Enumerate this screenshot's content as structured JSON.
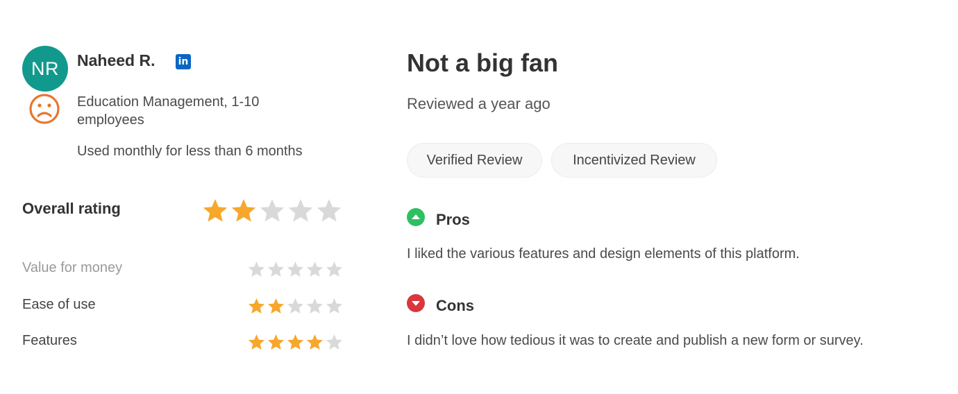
{
  "reviewer": {
    "initials": "NR",
    "name": "Naheed R.",
    "linkedin_label": "in",
    "sentiment_icon": "frown-face-icon",
    "industry": "Education Management, 1-10 employees",
    "usage": "Used monthly for less than 6 months",
    "avatar_color": "#12998d"
  },
  "ratings": {
    "overall_label": "Overall rating",
    "overall_value": 2,
    "max": 5,
    "items": [
      {
        "label": "Value for money",
        "value": 0
      },
      {
        "label": "Ease of use",
        "value": 2
      },
      {
        "label": "Features",
        "value": 4
      },
      {
        "label": "",
        "value": 4
      }
    ],
    "star_color_filled": "#f7a72b",
    "star_color_empty": "#d9d9d9"
  },
  "review": {
    "title": "Not a big fan",
    "date": "Reviewed a year ago",
    "badges": [
      "Verified Review",
      "Incentivized Review"
    ],
    "pros_title": "Pros",
    "pros_text": "I liked the various features and design elements of this platform.",
    "cons_title": "Cons",
    "cons_text": "I didn’t love how tedious it was to create and publish a new form or survey.",
    "pros_color": "#2fbf63",
    "cons_color": "#d9363e"
  }
}
